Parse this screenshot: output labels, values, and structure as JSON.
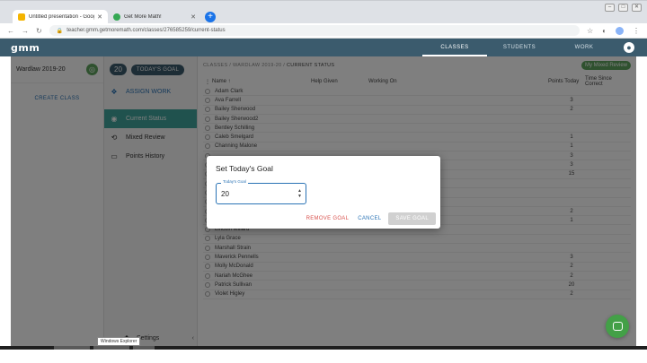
{
  "browser": {
    "tabs": [
      {
        "title": "Untitled presentation - Google S",
        "favicon_color": "#f4b400"
      },
      {
        "title": "Get More Math!",
        "favicon_color": "#34a853"
      }
    ],
    "new_tab": "+",
    "url": "teacher.gmm.getmoremath.com/classes/276585259/current-status"
  },
  "app": {
    "logo": "gmm",
    "nav": [
      "CLASSES",
      "STUDENTS",
      "WORK"
    ]
  },
  "class_panel": {
    "class_name": "Wardlaw 2019-20",
    "create_class": "CREATE CLASS"
  },
  "side_menu": {
    "goal_number": "20",
    "goal_label": "TODAY'S GOAL",
    "items": [
      "ASSIGN WORK",
      "Current Status",
      "Mixed Review",
      "Points History"
    ],
    "settings": "Settings",
    "tooltip": "Windows Explorer"
  },
  "main": {
    "breadcrumb_prefix": "CLASSES / WARDLAW 2019-20 /",
    "breadcrumb_current": "CURRENT STATUS",
    "mixed_review_button": "My Mixed Review",
    "columns": {
      "name": "Name",
      "help": "Help Given",
      "working": "Working On",
      "points": "Points Today",
      "time": "Time Since Correct"
    },
    "rows": [
      {
        "name": "Adam Clark",
        "points": ""
      },
      {
        "name": "Ava Farrell",
        "points": "3"
      },
      {
        "name": "Bailey Sherwood",
        "points": "2"
      },
      {
        "name": "Bailey Sherwood2",
        "points": ""
      },
      {
        "name": "Bentley Schilling",
        "points": ""
      },
      {
        "name": "Caleb Smelgard",
        "points": "1"
      },
      {
        "name": "Channing Malone",
        "points": "1"
      },
      {
        "name": "",
        "points": "3"
      },
      {
        "name": "",
        "points": "3"
      },
      {
        "name": "",
        "points": "15"
      },
      {
        "name": "",
        "points": ""
      },
      {
        "name": "",
        "points": ""
      },
      {
        "name": "",
        "points": ""
      },
      {
        "name": "",
        "points": "2"
      },
      {
        "name": "",
        "points": "1"
      },
      {
        "name": "Lincoln Millard",
        "points": ""
      },
      {
        "name": "Lyla Grace",
        "points": ""
      },
      {
        "name": "Marshall Strain",
        "points": ""
      },
      {
        "name": "Maverick Pennells",
        "points": "3"
      },
      {
        "name": "Molly McDonald",
        "points": "2"
      },
      {
        "name": "Nariah McGhee",
        "points": "2"
      },
      {
        "name": "Patrick Sullivan",
        "points": "20"
      },
      {
        "name": "Violet Higley",
        "points": "2"
      }
    ]
  },
  "dialog": {
    "title": "Set Today's Goal",
    "field_label": "Today's Goal",
    "field_value": "20",
    "remove_label": "REMOVE GOAL",
    "cancel_label": "CANCEL",
    "save_label": "SAVE GOAL"
  },
  "colors": {
    "app_bar": "#3b5b6d",
    "active_menu": "#40a59c",
    "accent_green": "#43a047",
    "link_blue": "#2a73b5",
    "remove_red": "#d9534f"
  }
}
